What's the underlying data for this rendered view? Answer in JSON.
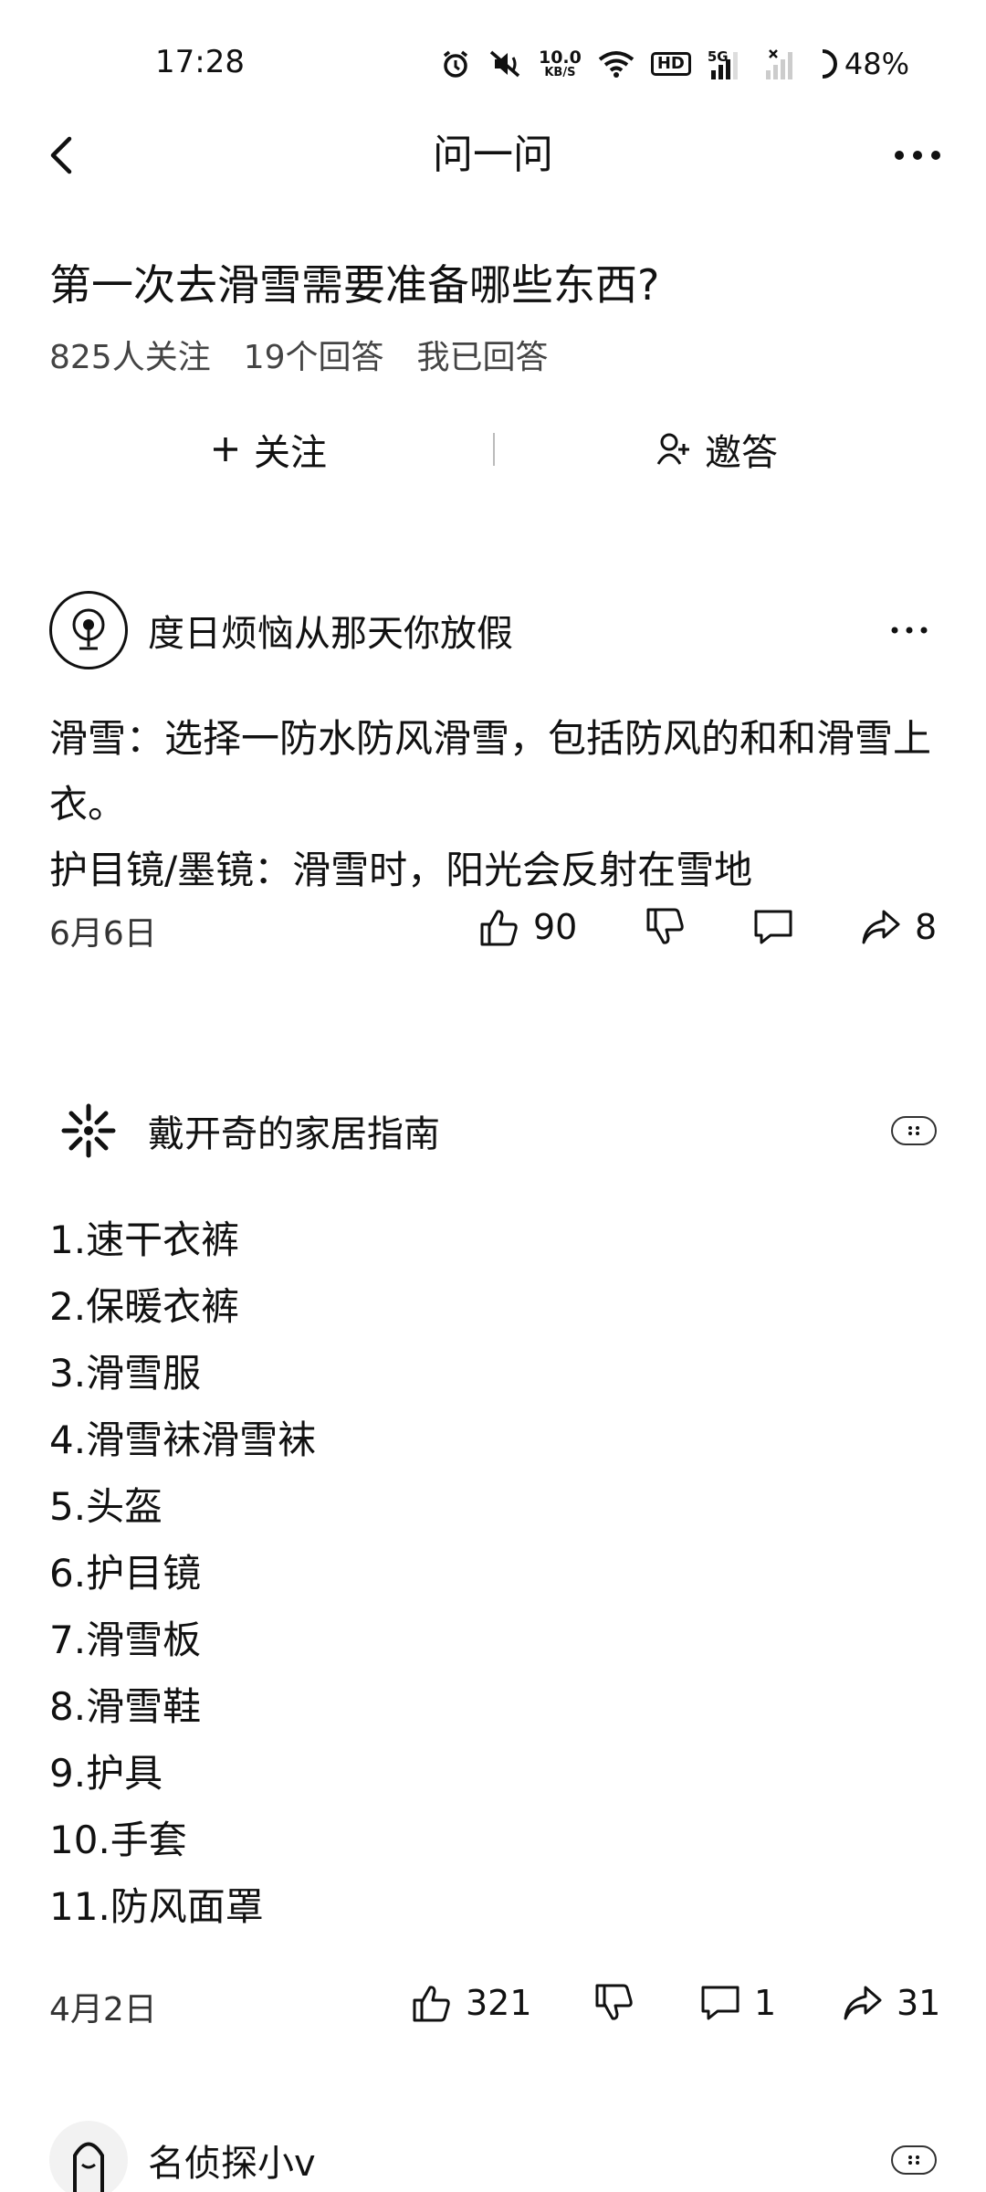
{
  "status": {
    "time": "17:28",
    "speed_value": "10.0",
    "speed_unit": "KB/S",
    "hd": "HD",
    "net": "5G",
    "battery": "48%"
  },
  "nav": {
    "title": "问一问"
  },
  "question": {
    "title": "第一次去滑雪需要准备哪些东西?",
    "followers": "825人关注",
    "answers_count": "19个回答",
    "answered": "我已回答",
    "follow_label": "关注",
    "invite_label": "邀答"
  },
  "answers": [
    {
      "author": "度日烦恼从那天你放假",
      "paragraphs": [
        "滑雪：选择一防水防风滑雪，包括防风的和和滑雪上衣。",
        "护目镜/墨镜：滑雪时，阳光会反射在雪地"
      ],
      "date": "6月6日",
      "likes": "90",
      "comments": "",
      "shares": "8"
    },
    {
      "author": "戴开奇的家居指南",
      "items": [
        "1.速干衣裤",
        "2.保暖衣裤",
        "3.滑雪服",
        "4.滑雪袜滑雪袜",
        "5.头盔",
        "6.护目镜",
        "7.滑雪板",
        "8.滑雪鞋",
        "9.护具",
        "10.手套",
        "11.防风面罩"
      ],
      "date": "4月2日",
      "likes": "321",
      "comments": "1",
      "shares": "31"
    },
    {
      "author": "名侦探小v"
    }
  ]
}
